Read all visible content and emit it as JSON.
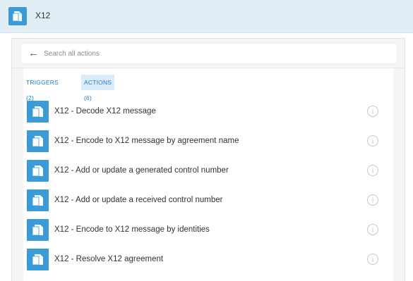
{
  "header": {
    "title": "X12",
    "icon": "x12-connector-icon"
  },
  "search": {
    "placeholder": "Search all actions",
    "back_icon": "back-arrow-icon"
  },
  "tabs": [
    {
      "label": "TRIGGERS (2)",
      "selected": false
    },
    {
      "label": "ACTIONS (6)",
      "selected": true
    }
  ],
  "actions": [
    {
      "label": "X12 - Decode X12 message"
    },
    {
      "label": "X12 - Encode to X12 message by agreement name"
    },
    {
      "label": "X12 - Add or update a generated control number"
    },
    {
      "label": "X12 - Add or update a received control number"
    },
    {
      "label": "X12 - Encode to X12 message by identities"
    },
    {
      "label": "X12 - Resolve X12 agreement"
    }
  ],
  "colors": {
    "accent": "#3b9bd6",
    "header_bg": "#e2eef6",
    "tab_text": "#1e7ccc",
    "tab_selected_bg": "#dcebfa"
  }
}
